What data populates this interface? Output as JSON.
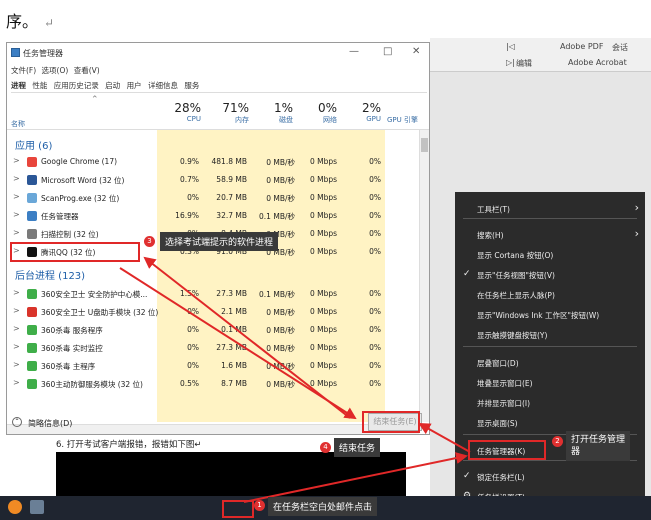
{
  "doc": {
    "top_text": "序。",
    "return_mark": "↵",
    "line6": "6. 打开考试客户端报错，报错如下图↵"
  },
  "ribbon": {
    "items": [
      "Adobe PDF",
      "会话",
      "编辑",
      "Adobe Acrobat"
    ],
    "small_icons": [
      "|◁",
      "▷|"
    ]
  },
  "task_manager": {
    "title": "任务管理器",
    "window_controls": [
      "—",
      "□",
      "✕"
    ],
    "menu": "文件(F)  选项(O)  查看(V)",
    "tabs": [
      "进程",
      "性能",
      "应用历史记录",
      "启动",
      "用户",
      "详细信息",
      "服务"
    ],
    "columns": {
      "name": "名称",
      "cpu": {
        "pct": "28%",
        "label": "CPU"
      },
      "mem": {
        "pct": "71%",
        "label": "内存"
      },
      "disk": {
        "pct": "1%",
        "label": "磁盘"
      },
      "net": {
        "pct": "0%",
        "label": "网络"
      },
      "gpu": {
        "pct": "2%",
        "label": "GPU"
      },
      "gpu_engine": {
        "label": "GPU 引擎"
      }
    },
    "apps_group": "应用 (6)",
    "apps": [
      {
        "name": "Google Chrome (17)",
        "cpu": "0.9%",
        "mem": "481.8 MB",
        "disk": "0 MB/秒",
        "net": "0 Mbps",
        "gpu": "0%",
        "color": "#e8453c"
      },
      {
        "name": "Microsoft Word (32 位)",
        "cpu": "0.7%",
        "mem": "58.9 MB",
        "disk": "0 MB/秒",
        "net": "0 Mbps",
        "gpu": "0%",
        "color": "#2b5797"
      },
      {
        "name": "ScanProg.exe (32 位)",
        "cpu": "0%",
        "mem": "20.7 MB",
        "disk": "0 MB/秒",
        "net": "0 Mbps",
        "gpu": "0%",
        "color": "#6aa7d8"
      },
      {
        "name": "任务管理器",
        "cpu": "16.9%",
        "mem": "32.7 MB",
        "disk": "0.1 MB/秒",
        "net": "0 Mbps",
        "gpu": "0%",
        "color": "#3c7fc4"
      },
      {
        "name": "扫描控制 (32 位)",
        "cpu": "0%",
        "mem": "8.4 MB",
        "disk": "0 MB/秒",
        "net": "0 Mbps",
        "gpu": "0%",
        "color": "#7a7a7a"
      },
      {
        "name": "腾讯QQ (32 位)",
        "cpu": "0.3%",
        "mem": "91.0 MB",
        "disk": "0 MB/秒",
        "net": "0 Mbps",
        "gpu": "0%",
        "color": "#111111"
      }
    ],
    "bg_group": "后台进程 (123)",
    "bg": [
      {
        "name": "360安全卫士 安全防护中心模...",
        "cpu": "1.5%",
        "mem": "27.3 MB",
        "disk": "0.1 MB/秒",
        "net": "0 Mbps",
        "gpu": "0%",
        "color": "#3fae49"
      },
      {
        "name": "360安全卫士 U盘助手模块 (32 位)",
        "cpu": "0%",
        "mem": "2.1 MB",
        "disk": "0 MB/秒",
        "net": "0 Mbps",
        "gpu": "0%",
        "color": "#d9342b"
      },
      {
        "name": "360杀毒 服务程序",
        "cpu": "0%",
        "mem": "0.1 MB",
        "disk": "0 MB/秒",
        "net": "0 Mbps",
        "gpu": "0%",
        "color": "#3fae49"
      },
      {
        "name": "360杀毒 实时监控",
        "cpu": "0%",
        "mem": "27.3 MB",
        "disk": "0 MB/秒",
        "net": "0 Mbps",
        "gpu": "0%",
        "color": "#3fae49"
      },
      {
        "name": "360杀毒 主程序",
        "cpu": "0%",
        "mem": "1.6 MB",
        "disk": "0 MB/秒",
        "net": "0 Mbps",
        "gpu": "0%",
        "color": "#3fae49"
      },
      {
        "name": "360主动防御服务模块 (32 位)",
        "cpu": "0.5%",
        "mem": "8.7 MB",
        "disk": "0 MB/秒",
        "net": "0 Mbps",
        "gpu": "0%",
        "color": "#3fae49"
      }
    ],
    "fewer_details": "简略信息(D)",
    "end_task": "结束任务(E)"
  },
  "context_menu": {
    "items": [
      {
        "label": "工具栏(T)",
        "check": false,
        "submenu": true
      },
      {
        "label": "搜索(H)",
        "check": false,
        "submenu": true
      },
      {
        "label": "显示 Cortana 按钮(O)",
        "check": false,
        "submenu": false
      },
      {
        "label": "显示\"任务视图\"按钮(V)",
        "check": true,
        "submenu": false
      },
      {
        "label": "在任务栏上显示人脉(P)",
        "check": false,
        "submenu": false
      },
      {
        "label": "显示\"Windows Ink 工作区\"按钮(W)",
        "check": false,
        "submenu": false
      },
      {
        "label": "显示触摸键盘按钮(Y)",
        "check": false,
        "submenu": false
      },
      {
        "label": "层叠窗口(D)",
        "check": false,
        "submenu": false
      },
      {
        "label": "堆叠显示窗口(E)",
        "check": false,
        "submenu": false
      },
      {
        "label": "并排显示窗口(I)",
        "check": false,
        "submenu": false
      },
      {
        "label": "显示桌面(S)",
        "check": false,
        "submenu": false
      },
      {
        "label": "任务管理器(K)",
        "check": false,
        "submenu": false
      },
      {
        "label": "锁定任务栏(L)",
        "check": true,
        "submenu": false
      },
      {
        "label": "任务栏设置(T)",
        "check": false,
        "submenu": false
      }
    ]
  },
  "callouts": {
    "c1": {
      "num": "1",
      "text": "在任务栏空白处邮件点击"
    },
    "c2": {
      "num": "2",
      "text": "打开任务管理\n器"
    },
    "c3": {
      "num": "3",
      "text": "选择考试端提示的软件进程"
    },
    "c4": {
      "num": "4",
      "text": "结束任务"
    }
  }
}
